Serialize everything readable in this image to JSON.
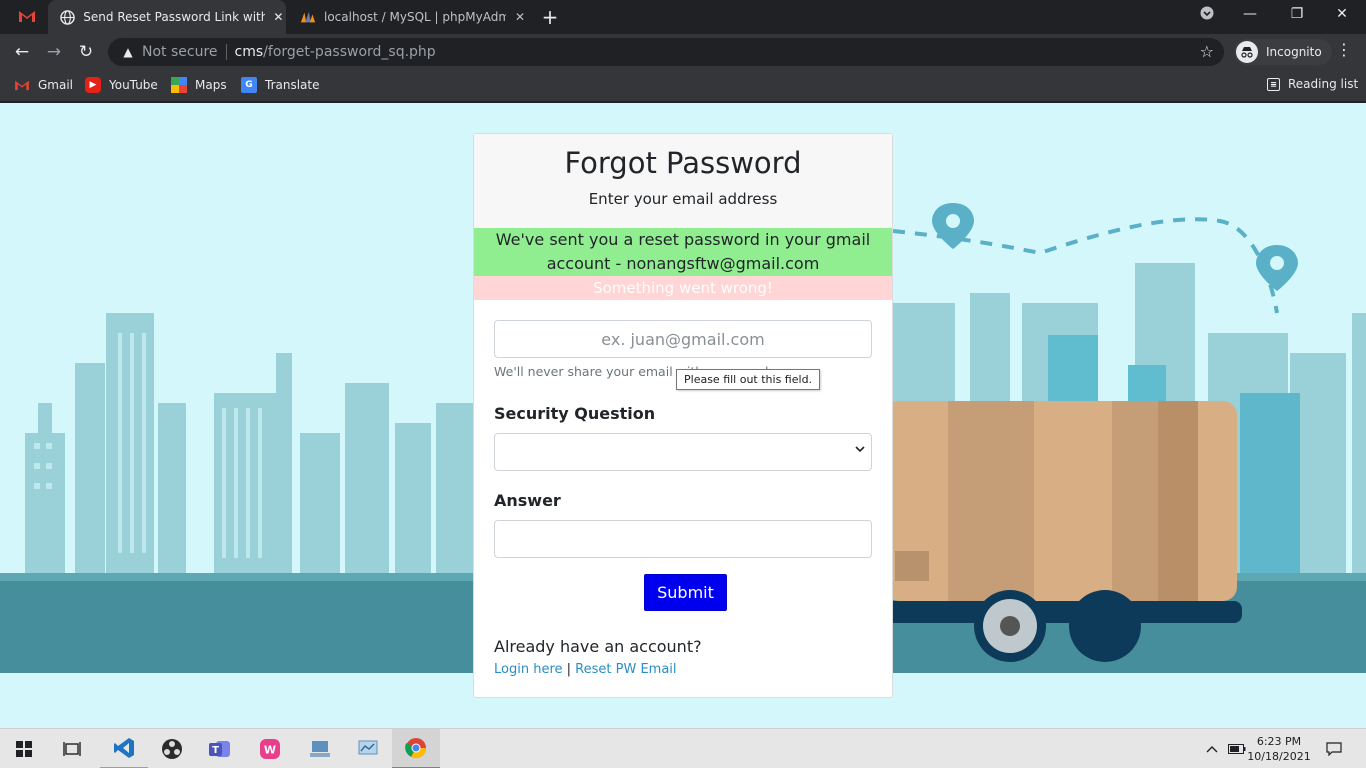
{
  "browser": {
    "tabs": [
      {
        "title": "Send Reset Password Link with Ex",
        "active": true
      },
      {
        "title": "localhost / MySQL | phpMyAdmin",
        "active": false
      }
    ],
    "security_label": "Not secure",
    "url_host": "cms",
    "url_path": "/forget-password_sq.php",
    "profile_label": "Incognito",
    "bookmarks": [
      "Gmail",
      "YouTube",
      "Maps",
      "Translate"
    ],
    "reading_list": "Reading list"
  },
  "page": {
    "title": "Forgot Password",
    "subtitle": "Enter your email address",
    "success_message": "We've sent you a reset password in your gmail account - nonangsftw@gmail.com",
    "error_message": "Something went wrong!",
    "email_placeholder": "ex. juan@gmail.com",
    "email_helper": "We'll never share your email with anyone else.",
    "validation_tooltip": "Please fill out this field.",
    "security_question_label": "Security Question",
    "security_question_value": "",
    "answer_label": "Answer",
    "submit_label": "Submit",
    "account_prompt": "Already have an account?",
    "login_link": "Login here",
    "link_separator": "|",
    "reset_link": "Reset PW Email"
  },
  "taskbar": {
    "time": "6:23 PM",
    "date": "10/18/2021"
  },
  "colors": {
    "page_bg": "#d4f7fb",
    "success_bg": "#90ee90",
    "error_bg": "#ffd5d5",
    "submit_bg": "#0000ee",
    "link": "#2a8dc4"
  }
}
